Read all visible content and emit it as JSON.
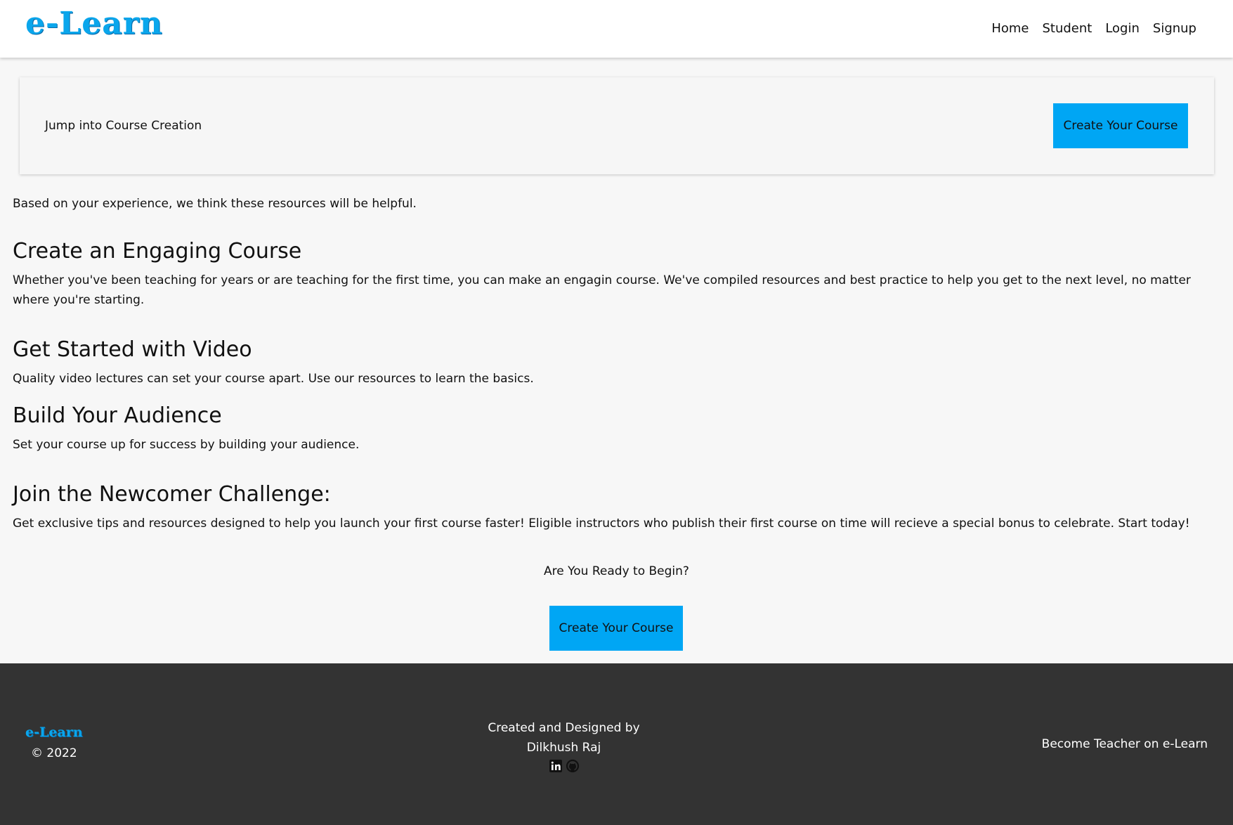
{
  "header": {
    "logo": "e-Learn",
    "nav": [
      "Home",
      "Student",
      "Login",
      "Signup"
    ]
  },
  "banner": {
    "text": "Jump into Course Creation",
    "button": "Create Your Course"
  },
  "intro": "Based on your experience, we think these resources will be helpful.",
  "sections": [
    {
      "title": "Create an Engaging Course",
      "body": "Whether you've been teaching for years or are teaching for the first time, you can make an engagin course. We've compiled resources and best practice to help you get to the next level, no matter where you're starting."
    },
    {
      "title": "Get Started with Video",
      "body": "Quality video lectures can set your course apart. Use our resources to learn the basics."
    },
    {
      "title": "Build Your Audience",
      "body": "Set your course up for success by building your audience."
    },
    {
      "title": "Join the Newcomer Challenge:",
      "body": "Get exclusive tips and resources designed to help you launch your first course faster! Eligible instructors who publish their first course on time will recieve a special bonus to celebrate. Start today!"
    }
  ],
  "cta": {
    "question": "Are You Ready to Begin?",
    "button": "Create Your Course"
  },
  "footer": {
    "logo": "e-Learn",
    "copyright": "© 2022",
    "credit_line1": "Created and Designed by",
    "credit_line2": "Dilkhush Raj",
    "icons": [
      "linkedin-icon",
      "github-icon"
    ],
    "teach_link": "Become Teacher on e-Learn"
  },
  "colors": {
    "accent": "#00a6f4",
    "footer_bg": "#333333",
    "page_bg": "#f7f7f7"
  }
}
